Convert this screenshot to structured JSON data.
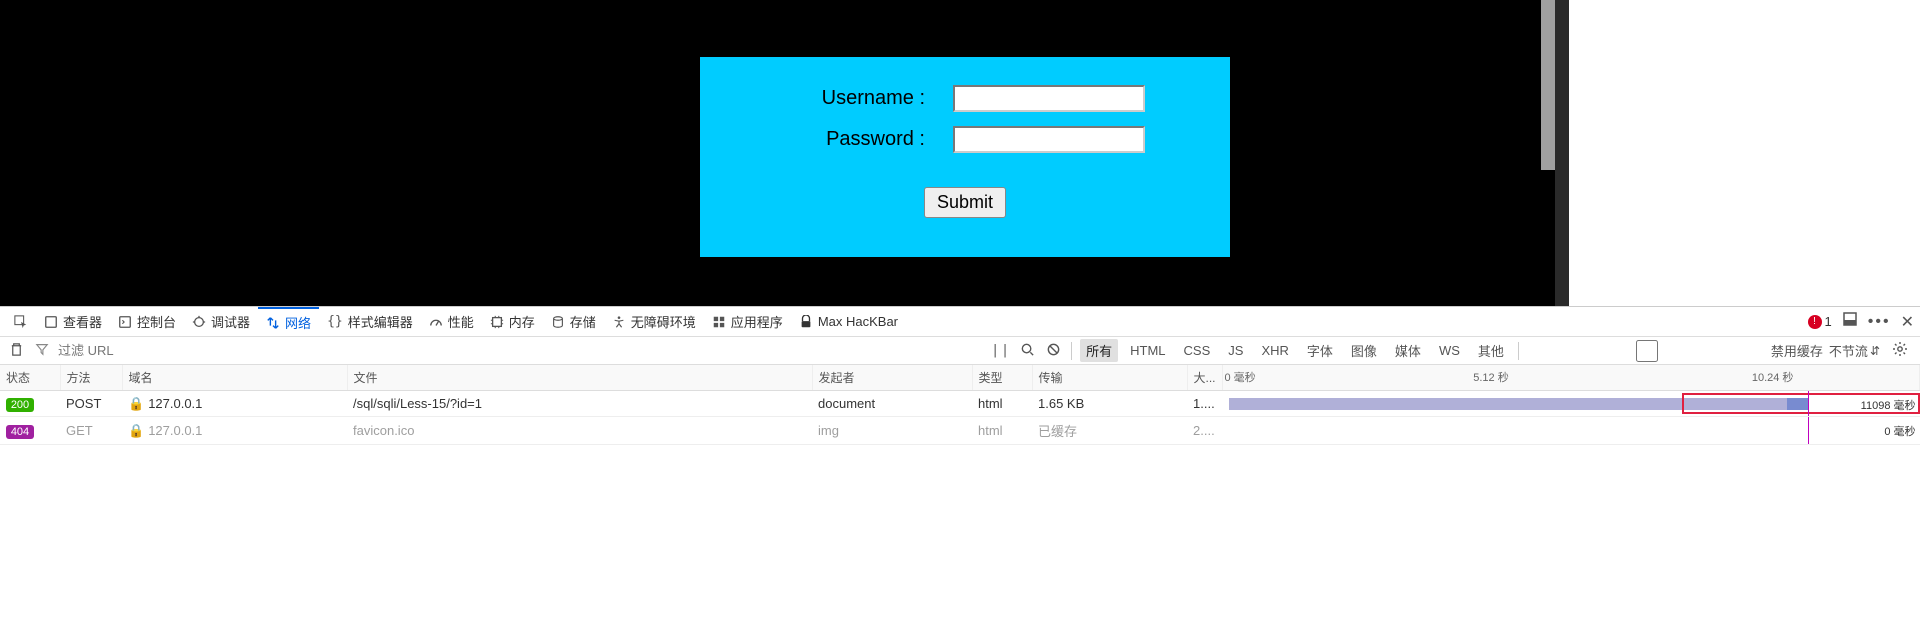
{
  "form": {
    "username_label": "Username :",
    "password_label": "Password :",
    "username_value": "",
    "password_value": "",
    "submit_label": "Submit"
  },
  "devtools": {
    "tabs": {
      "inspector": "查看器",
      "console": "控制台",
      "debugger": "调试器",
      "network": "网络",
      "styleeditor": "样式编辑器",
      "performance": "性能",
      "memory": "内存",
      "storage": "存储",
      "accessibility": "无障碍环境",
      "application": "应用程序",
      "hackbar": "Max HacKBar"
    },
    "error_count": "1",
    "filter_placeholder": "过滤 URL",
    "type_filters": [
      "所有",
      "HTML",
      "CSS",
      "JS",
      "XHR",
      "字体",
      "图像",
      "媒体",
      "WS",
      "其他"
    ],
    "disable_cache_label": "禁用缓存",
    "throttle_label": "不节流",
    "columns": {
      "status": "状态",
      "method": "方法",
      "domain": "域名",
      "file": "文件",
      "initiator": "发起者",
      "type": "类型",
      "transferred": "传输",
      "size": "大...",
      "waterfall_0": "0 毫秒",
      "waterfall_mid": "5.12 秒",
      "waterfall_end": "10.24 秒"
    },
    "rows": [
      {
        "status": "200",
        "status_class": "status-200",
        "method": "POST",
        "domain": "127.0.0.1",
        "file": "/sql/sqli/Less-15/?id=1",
        "initiator": "document",
        "type": "html",
        "transferred": "1.65 KB",
        "size": "1....",
        "duration": "11098 毫秒",
        "dim": false
      },
      {
        "status": "404",
        "status_class": "status-404",
        "method": "GET",
        "domain": "127.0.0.1",
        "file": "favicon.ico",
        "initiator": "img",
        "type": "html",
        "transferred": "已缓存",
        "size": "2....",
        "duration": "0 毫秒",
        "dim": true
      }
    ]
  }
}
